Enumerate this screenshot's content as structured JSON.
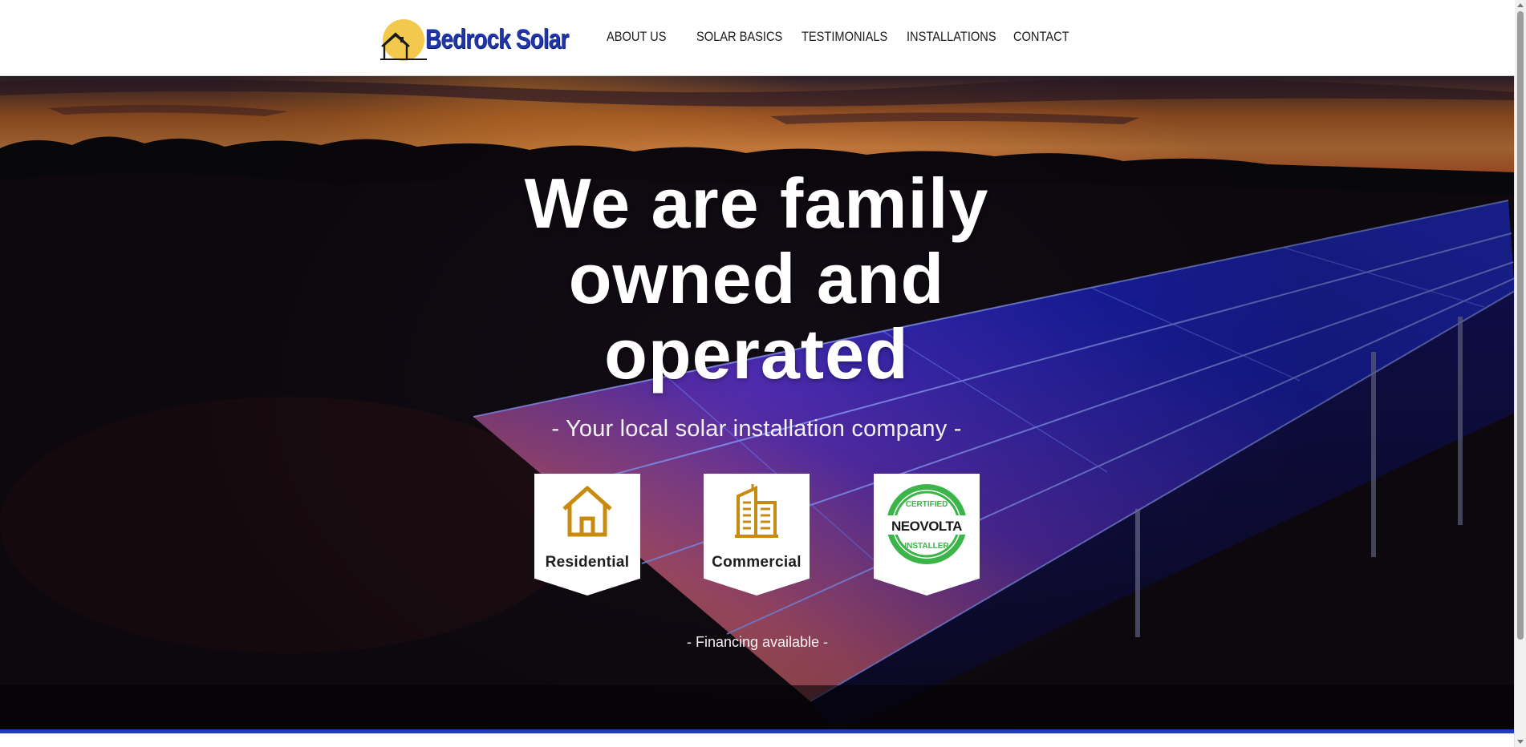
{
  "header": {
    "logo_text": "Bedrock Solar",
    "nav": [
      {
        "label": "ABOUT US"
      },
      {
        "label": "SOLAR BASICS"
      },
      {
        "label": "TESTIMONIALS"
      },
      {
        "label": "INSTALLATIONS"
      },
      {
        "label": "CONTACT"
      }
    ]
  },
  "hero": {
    "headline": "We are family owned and operated",
    "tagline": "- Your local solar installation company -",
    "badges": [
      {
        "label": "Residential",
        "icon": "house-icon"
      },
      {
        "label": "Commercial",
        "icon": "building-icon"
      },
      {
        "label": "",
        "icon": "neovolta-certified-installer-logo",
        "seal_text": [
          "CERTIFIED",
          "NEOVOLTA",
          "INSTALLER"
        ]
      }
    ],
    "financing": "- Financing available -"
  },
  "colors": {
    "brand_blue": "#1f35a8",
    "logo_sun": "#f2c94c",
    "icon_gold": "#c98a10",
    "seal_green": "#3bb54a",
    "strip_blue": "#1c3fb8"
  }
}
